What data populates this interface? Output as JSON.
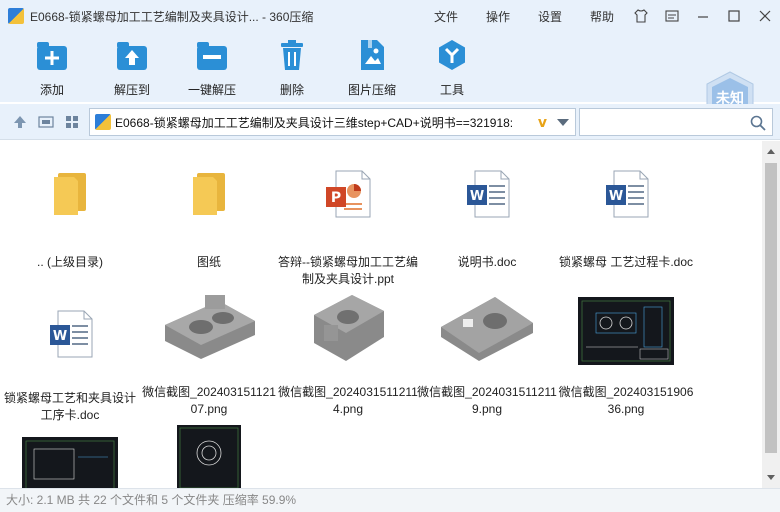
{
  "window": {
    "title": "E0668-锁紧螺母加工工艺编制及夹具设计... - 360压缩",
    "menu": [
      "文件",
      "操作",
      "设置",
      "帮助"
    ]
  },
  "toolbar": {
    "buttons": [
      {
        "label": "添加",
        "icon": "add-icon"
      },
      {
        "label": "解压到",
        "icon": "extract-to-icon"
      },
      {
        "label": "一键解压",
        "icon": "one-click-extract-icon"
      },
      {
        "label": "删除",
        "icon": "delete-icon"
      },
      {
        "label": "图片压缩",
        "icon": "image-compress-icon"
      },
      {
        "label": "工具",
        "icon": "tools-icon"
      }
    ],
    "badge": "未知"
  },
  "address": {
    "path": "E0668-锁紧螺母加工工艺编制及夹具设计三维step+CAD+说明书==321918:",
    "search_placeholder": ""
  },
  "files": [
    {
      "name": ".. (上级目录)",
      "type": "folder"
    },
    {
      "name": "图纸",
      "type": "folder"
    },
    {
      "name": "答辩--锁紧螺母加工工艺编制及夹具设计.ppt",
      "type": "ppt"
    },
    {
      "name": "说明书.doc",
      "type": "doc"
    },
    {
      "name": "锁紧螺母 工艺过程卡.doc",
      "type": "doc"
    },
    {
      "name": "锁紧螺母工艺和夹具设计工序卡.doc",
      "type": "doc"
    },
    {
      "name": "微信截图_20240315112107.png",
      "type": "png-3d"
    },
    {
      "name": "微信截图_20240315112114.png",
      "type": "png-3d"
    },
    {
      "name": "微信截图_20240315112119.png",
      "type": "png-3d"
    },
    {
      "name": "微信截图_20240315190636.png",
      "type": "png-cad"
    },
    {
      "name": "",
      "type": "png-cad"
    },
    {
      "name": "",
      "type": "png-cad"
    }
  ],
  "status": "大小: 2.1 MB 共 22 个文件和 5 个文件夹 压缩率 59.9%",
  "colors": {
    "accent": "#2b8fd6",
    "chrome": "#e8f1fb",
    "folder": "#f5c955",
    "word": "#2b5797",
    "ppt": "#d04727"
  }
}
